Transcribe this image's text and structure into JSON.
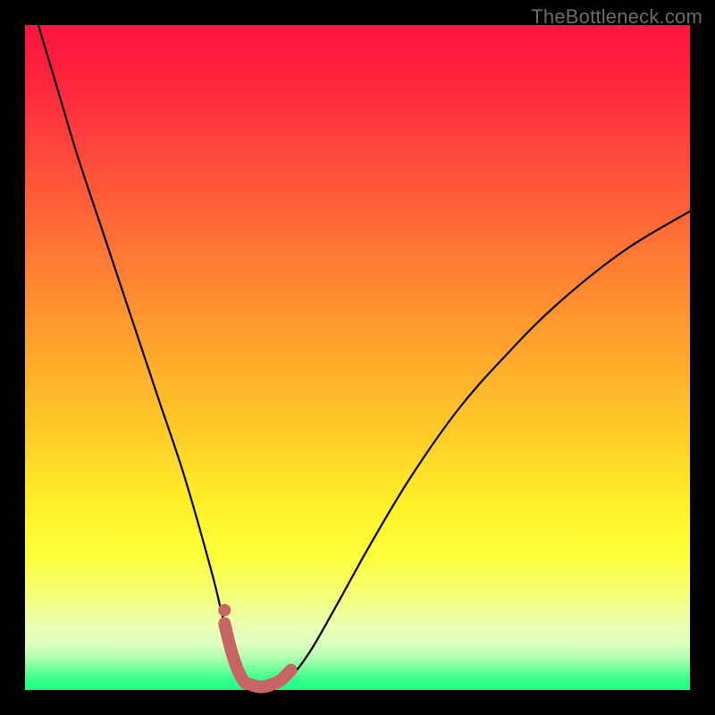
{
  "watermark": {
    "text": "TheBottleneck.com"
  },
  "colors": {
    "curve_stroke": "#000000",
    "marker_stroke": "#c96464",
    "marker_fill": "#c96464"
  },
  "chart_data": {
    "type": "line",
    "title": "",
    "xlabel": "",
    "ylabel": "",
    "xlim": [
      0,
      100
    ],
    "ylim": [
      0,
      100
    ],
    "grid": false,
    "series": [
      {
        "name": "bottleneck-curve",
        "x": [
          2,
          5,
          8,
          12,
          16,
          20,
          24,
          28,
          30,
          32,
          34,
          36,
          38,
          40,
          43,
          47,
          52,
          58,
          65,
          72,
          80,
          90,
          100
        ],
        "values": [
          100,
          90,
          80,
          68,
          56,
          44,
          32,
          18,
          10,
          4,
          0.8,
          0.5,
          0.8,
          2,
          6,
          13,
          22,
          32,
          42,
          50,
          58,
          66,
          72
        ]
      }
    ],
    "markers": {
      "name": "highlight-segment",
      "x": [
        30.0,
        31.0,
        32.0,
        33.0,
        34.0,
        35.0,
        36.0,
        37.0,
        38.5,
        40.0
      ],
      "values": [
        10.0,
        6.0,
        3.0,
        1.2,
        0.8,
        0.5,
        0.5,
        0.8,
        1.5,
        3.0
      ],
      "dot": {
        "x": 30.0,
        "value": 12.0
      }
    }
  }
}
